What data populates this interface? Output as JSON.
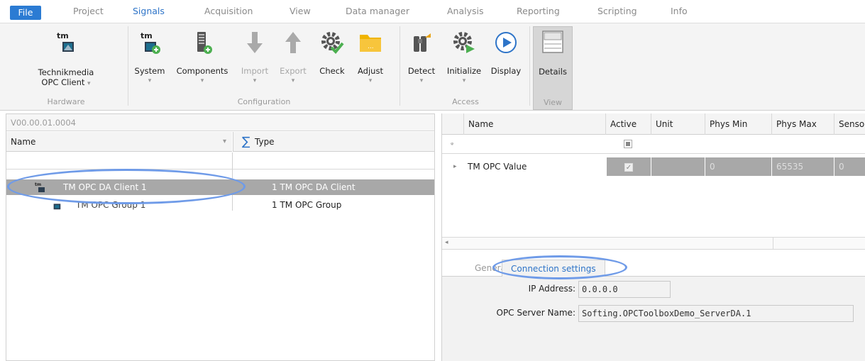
{
  "menu": {
    "items": [
      "File",
      "Project",
      "Signals",
      "Acquisition",
      "View",
      "Data manager",
      "Analysis",
      "Reporting",
      "Scripting",
      "Info"
    ]
  },
  "ribbon": {
    "hardware": {
      "btn_line1": "Technikmedia",
      "btn_line2": "OPC Client",
      "group": "Hardware"
    },
    "configuration": {
      "system": "System",
      "components": "Components",
      "import": "Import",
      "export": "Export",
      "check": "Check",
      "adjust": "Adjust",
      "group": "Configuration"
    },
    "access": {
      "detect": "Detect",
      "initialize": "Initialize",
      "display": "Display",
      "group": "Access"
    },
    "view": {
      "details": "Details",
      "group": "View"
    },
    "tm_logo": "tm"
  },
  "tree": {
    "version": "V00.00.01.0004",
    "col_name": "Name",
    "col_type": "Type",
    "sum_symbol": "∑",
    "rows": [
      {
        "name": "TM OPC DA Client 1",
        "type": "1 TM OPC DA Client"
      },
      {
        "name": "TM OPC Group 1",
        "type": "1 TM OPC Group"
      }
    ]
  },
  "grid": {
    "headers": [
      "Name",
      "Active",
      "Unit",
      "Phys Min",
      "Phys Max",
      "Senso"
    ],
    "row": {
      "name": "TM OPC Value",
      "active": true,
      "unit": "",
      "phys_min": "0",
      "phys_max": "65535",
      "sensor": "0"
    }
  },
  "details": {
    "tabs": [
      "General",
      "Connection settings"
    ],
    "ip_label": "IP Address:",
    "ip_value": "0.0.0.0",
    "server_label": "OPC Server Name:",
    "server_value": "Softing.OPCToolboxDemo_ServerDA.1"
  },
  "colors": {
    "accent": "#2b7bd3",
    "selection": "#a8a8a8",
    "highlight_ellipse": "#6f9be8"
  }
}
